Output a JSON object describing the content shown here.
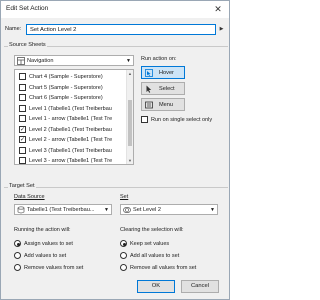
{
  "window": {
    "title": "Edit Set Action"
  },
  "name": {
    "label": "Name:",
    "value": "Set Action Level 2"
  },
  "source_sheets": {
    "section_label": "Source Sheets",
    "selector": "Navigation",
    "items": [
      {
        "label": "Chart 4 (Sample - Superstore)",
        "checked": false
      },
      {
        "label": "Chart 5 (Sample - Superstore)",
        "checked": false
      },
      {
        "label": "Chart 6 (Sample - Superstore)",
        "checked": false
      },
      {
        "label": "Level 1 (Tabelle1 (Test Treiberbau",
        "checked": false
      },
      {
        "label": "Level 1 - arrow (Tabelle1 (Test Tre",
        "checked": false
      },
      {
        "label": "Level 2 (Tabelle1 (Test Treiberbau",
        "checked": true
      },
      {
        "label": "Level 2 - arrow (Tabelle1 (Test Tre",
        "checked": true
      },
      {
        "label": "Level 3 (Tabelle1 (Test Treiberbau",
        "checked": false
      },
      {
        "label": "Level 3 - arrow (Tabelle1 (Test Tre",
        "checked": false
      }
    ]
  },
  "run_action": {
    "label": "Run action on:",
    "buttons": [
      {
        "label": "Hover",
        "selected": true,
        "icon": "hover-icon"
      },
      {
        "label": "Select",
        "selected": false,
        "icon": "select-cursor-icon"
      },
      {
        "label": "Menu",
        "selected": false,
        "icon": "menu-icon"
      }
    ],
    "single_select_label": "Run on single select only",
    "single_select_checked": false
  },
  "target_set": {
    "section_label": "Target Set",
    "data_source_label": "Data Source",
    "data_source_value": "Tabelle1 (Test Treiberbau...",
    "set_label": "Set",
    "set_value": "Set Level 2"
  },
  "running": {
    "label": "Running the action will:",
    "options": [
      {
        "label": "Assign values to set",
        "selected": true
      },
      {
        "label": "Add values to set",
        "selected": false
      },
      {
        "label": "Remove values from set",
        "selected": false
      }
    ]
  },
  "clearing": {
    "label": "Clearing the selection will:",
    "options": [
      {
        "label": "Keep set values",
        "selected": true
      },
      {
        "label": "Add all values to set",
        "selected": false
      },
      {
        "label": "Remove all values from set",
        "selected": false
      }
    ]
  },
  "footer": {
    "ok": "OK",
    "cancel": "Cancel"
  },
  "colors": {
    "accent": "#0078d7",
    "dialog_bg": "#f0f0f0",
    "selected_bg": "#cce4f7"
  }
}
